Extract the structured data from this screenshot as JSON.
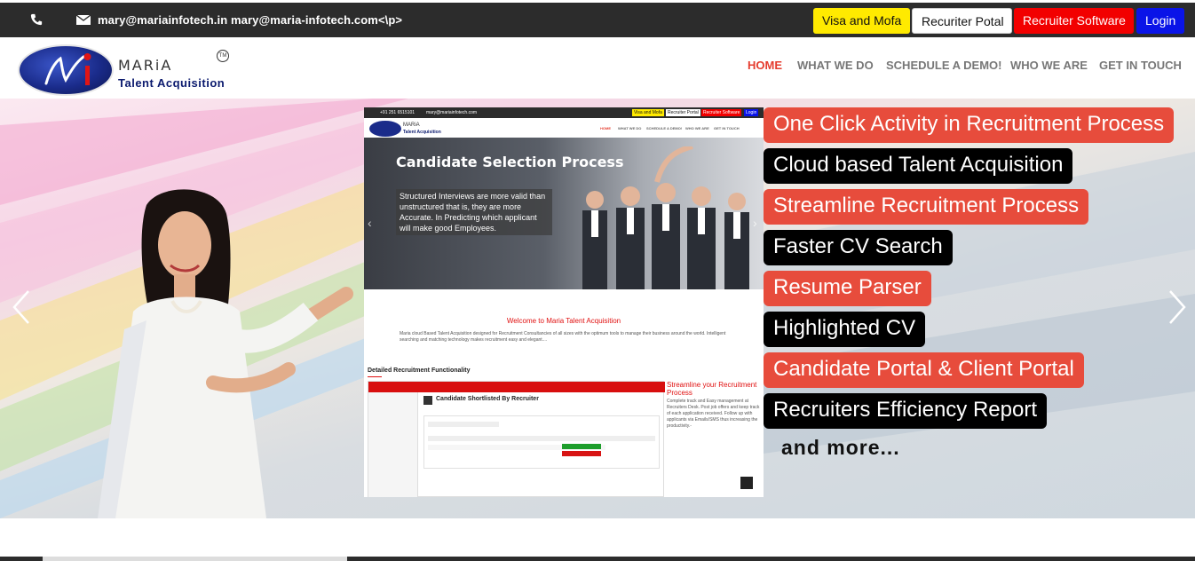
{
  "topbar": {
    "emails": "mary@mariainfotech.in   mary@maria-infotech.com<\\p>",
    "buttons": {
      "visa": "Visa and Mofa",
      "portal": "Recuriter Potal",
      "software": "Recruiter Software",
      "login": "Login"
    }
  },
  "header": {
    "logo_name": "MARiA",
    "logo_sub": "Talent Acquisition",
    "logo_tm": "TM",
    "nav": [
      "HOME",
      "WHAT WE DO",
      "SCHEDULE A DEMO!",
      "WHO WE ARE",
      "GET IN TOUCH"
    ]
  },
  "hero": {
    "features": [
      {
        "text": "One Click Activity in Recruitment Process",
        "color": "red"
      },
      {
        "text": "Cloud based Talent Acquisition",
        "color": "black"
      },
      {
        "text": "Streamline Recruitment Process",
        "color": "red"
      },
      {
        "text": "Faster CV Search",
        "color": "black"
      },
      {
        "text": "Resume Parser",
        "color": "red"
      },
      {
        "text": "Highlighted CV",
        "color": "black"
      },
      {
        "text": "Candidate Portal & Client Portal",
        "color": "red"
      },
      {
        "text": "Recruiters Efficiency Report",
        "color": "black"
      }
    ],
    "and_more": "and more...",
    "colors": {
      "red": "#e74c3c",
      "black": "#000000"
    }
  },
  "screenshot": {
    "phone": "+91 251 6515101",
    "email": "mary@mariainfotech.com",
    "buttons": [
      "Visa and Mofa",
      "Recruiter Portal",
      "Recruiter Software",
      "Login"
    ],
    "logo_name": "MARiA",
    "logo_sub": "Talent Acquisition",
    "nav": [
      "HOME",
      "WHAT WE DO",
      "SCHEDULE A DEMO!",
      "WHO WE ARE",
      "GET IN TOUCH"
    ],
    "banner_title": "Candidate Selection Process",
    "banner_text": "Structured Interviews are more valid than unstructured that is, they are more Accurate. In Predicting which applicant will make good Employees.",
    "welcome": "Welcome to Maria Talent Acquisition",
    "welcome_text": "Maria cloud Based Talent Acquisition designed for Recruitment Consultancies of all sizes with the optimum tools to manage their business around the world. Intelligent searching and matching technology makes recruitment easy and elegant....",
    "detailed": "Detailed Recruitment Functionality",
    "app_title": "Candidate Shortlisted By Recruiter",
    "stream_title": "Streamline your Recruitment Process",
    "stream_text": "Complete track and Easy management at Recruiters Desk. Post job offers and keep track of each application received. Follow up with applicants via Emails/SMS thus increasing the productivity.-"
  }
}
